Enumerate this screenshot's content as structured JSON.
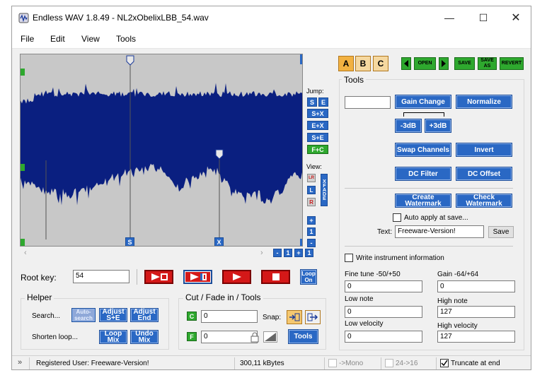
{
  "window": {
    "title": "Endless WAV 1.8.49 - NL2xObelixLBB_54.wav"
  },
  "menu": [
    "File",
    "Edit",
    "View",
    "Tools"
  ],
  "jump": {
    "label": "Jump:",
    "buttons": [
      "S",
      "E",
      "S+X",
      "E+X",
      "S+E",
      "F+C"
    ]
  },
  "view": {
    "label": "View:",
    "buttons": [
      "LR",
      "L",
      "R"
    ],
    "xfade": "XFADE"
  },
  "zoom": [
    "+",
    "1",
    "-"
  ],
  "markers": {
    "s": "S",
    "x": "X",
    "c": "C",
    "ruler": [
      "-",
      "1",
      "+",
      "1"
    ]
  },
  "root_key": {
    "label": "Root key:",
    "value": "54"
  },
  "loop_on": "Loop On",
  "helper": {
    "title": "Helper",
    "search_label": "Search...",
    "shorten_label": "Shorten loop...",
    "buttons": {
      "auto_search": "Auto-search",
      "adjust_se": "Adjust S+E",
      "adjust_end": "Adjust End",
      "loop_mix": "Loop Mix",
      "undo_mix": "Undo Mix"
    }
  },
  "cut": {
    "title": "Cut / Fade in / Tools",
    "c_label": "C",
    "c_value": "0",
    "f_label": "F",
    "f_value": "0",
    "snap_label": "Snap:",
    "tools_button": "Tools"
  },
  "top_buttons": {
    "a": "A",
    "b": "B",
    "c": "C",
    "open": "OPEN",
    "save": "SAVE",
    "save_as": "SAVE AS",
    "revert": "REVERT"
  },
  "tools": {
    "title": "Tools",
    "gain_value": "",
    "gain_change": "Gain Change",
    "normalize": "Normalize",
    "minus3": "-3dB",
    "plus3": "+3dB",
    "swap_channels": "Swap Channels",
    "invert": "Invert",
    "dc_filter": "DC Filter",
    "dc_offset": "DC Offset",
    "create_watermark": "Create Watermark",
    "check_watermark": "Check Watermark",
    "auto_apply": "Auto apply at save...",
    "text_label": "Text:",
    "text_value": "Freeware-Version!",
    "save": "Save",
    "write_instrument": "Write instrument information",
    "fine_tune_label": "Fine tune -50/+50",
    "fine_tune_value": "0",
    "gain_label": "Gain -64/+64",
    "gain_field_value": "0",
    "low_note_label": "Low note",
    "low_note_value": "0",
    "high_note_label": "High note",
    "high_note_value": "127",
    "low_vel_label": "Low velocity",
    "low_vel_value": "0",
    "high_vel_label": "High velocity",
    "high_vel_value": "127"
  },
  "status": {
    "registered": "Registered User: Freeware-Version!",
    "size": "300,11 kBytes",
    "mono": "->Mono",
    "bits": "24->16",
    "truncate": "Truncate at end"
  },
  "colors": {
    "wave": "#0a1f80",
    "wave_bg": "#c8c8c8",
    "blue_button": "#2a68c4",
    "red_button": "#d41818",
    "green_button": "#2ea82e",
    "abc_button": "#f2b141"
  }
}
